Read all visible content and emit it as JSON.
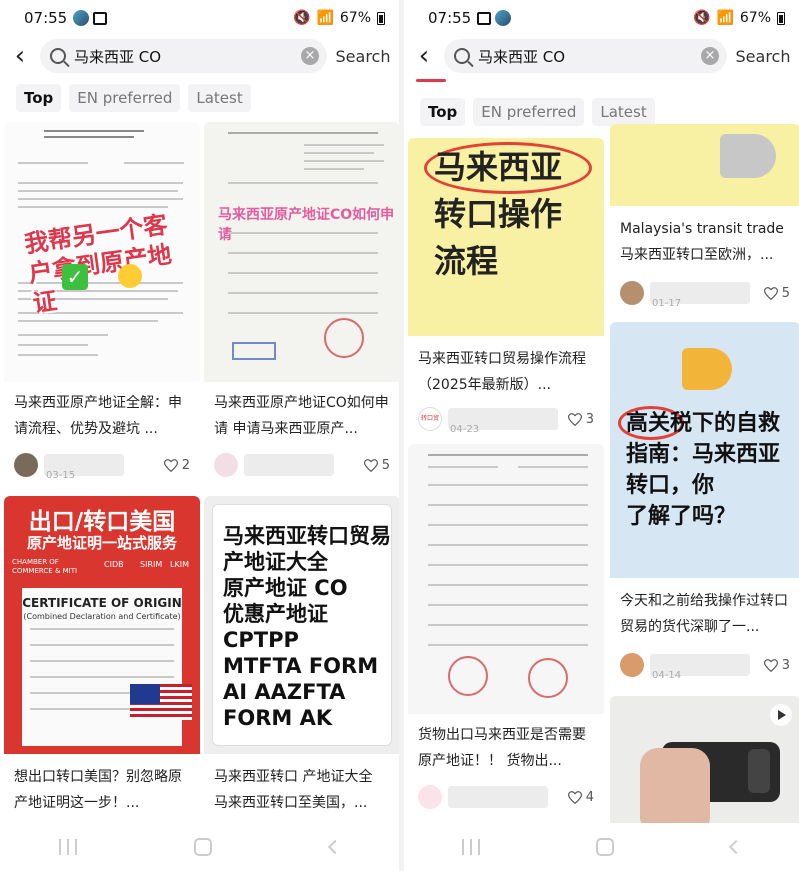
{
  "status": {
    "time": "07:55",
    "battery": "67%"
  },
  "search": {
    "query": "马来西亚 CO",
    "button": "Search"
  },
  "filters": [
    "Top",
    "EN preferred",
    "Latest"
  ],
  "left": {
    "posts": [
      {
        "overlay_title": "我帮另一个客户拿到原产地证",
        "caption": "马来西亚原产地证全解：申请流程、优势及避坑 ...",
        "date": "03-15",
        "likes": "2"
      },
      {
        "overlay_title": "马来西亚原产地证CO如何申请",
        "caption": "马来西亚原产地证CO如何申请 申请马来西亚原产...",
        "likes": "5"
      },
      {
        "banner_title": "出口/转口美国",
        "banner_subtitle": "原产地证明一站式服务",
        "cert_title": "CERTIFICATE OF ORIGIN",
        "cert_subtitle": "(Combined Declaration and Certificate)",
        "logos": [
          "CHAMBER OF COMMERCE & MITI",
          "CIDB",
          "SIRIM",
          "LKIM"
        ],
        "caption": "想出口转口美国？别忽略原产地证明这一步！..."
      },
      {
        "big_lines": [
          "马来西亚转口贸易",
          "产地证大全",
          "原产地证 CO",
          "优惠产地证",
          "CPTPP",
          "MTFTA FORM",
          "AI AAZFTA",
          "FORM AK"
        ],
        "caption": "马来西亚转口 产地证大全 马来西亚转口至美国，..."
      }
    ]
  },
  "right": {
    "posts": [
      {
        "thumb_lines": [
          "马来西亚",
          "转口操作",
          "流程"
        ],
        "caption": "马来西亚转口贸易操作流程（2025年最新版）...",
        "author_logo": "转口贸易",
        "date": "04-23",
        "likes": "3"
      },
      {
        "caption": "Malaysia's transit trade 马来西亚转口至欧洲，...",
        "date": "01-17",
        "likes": "5"
      },
      {
        "caption": "货物出口马来西亚是否需要原产地证！！ 货物出...",
        "likes": "4"
      },
      {
        "thumb_lines": [
          "高关税下的自救",
          "指南：马来西亚",
          "转口，你",
          "了解了吗？"
        ],
        "caption": "今天和之前给我操作过转口贸易的货代深聊了一...",
        "date": "04-14",
        "likes": "3"
      },
      {
        "caption": ""
      }
    ]
  }
}
